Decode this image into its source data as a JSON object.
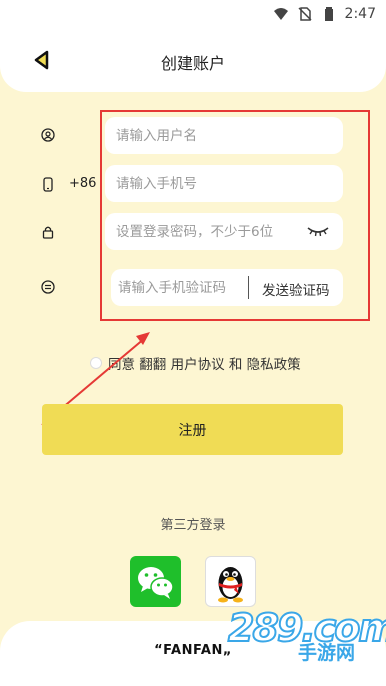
{
  "status_bar": {
    "time": "2:47"
  },
  "header": {
    "title": "创建账户"
  },
  "form": {
    "username_placeholder": "请输入用户名",
    "phone_prefix": "+86",
    "phone_placeholder": "请输入手机号",
    "password_placeholder": "设置登录密码，不少于6位",
    "code_placeholder": "请输入手机验证码",
    "send_code_label": "发送验证码"
  },
  "agreement": {
    "text": "同意 翻翻 用户协议 和 隐私政策"
  },
  "register": {
    "label": "注册"
  },
  "third_party": {
    "label": "第三方登录",
    "providers": [
      "wechat-icon",
      "qq-icon"
    ]
  },
  "footer": {
    "brand": "“FANFAN„"
  },
  "watermark": {
    "text": "289.com",
    "sub": "手游网"
  },
  "colors": {
    "background": "#fdf6d2",
    "accent": "#f0dc55",
    "highlight": "#e53935",
    "wechat": "#1fbf2b"
  }
}
